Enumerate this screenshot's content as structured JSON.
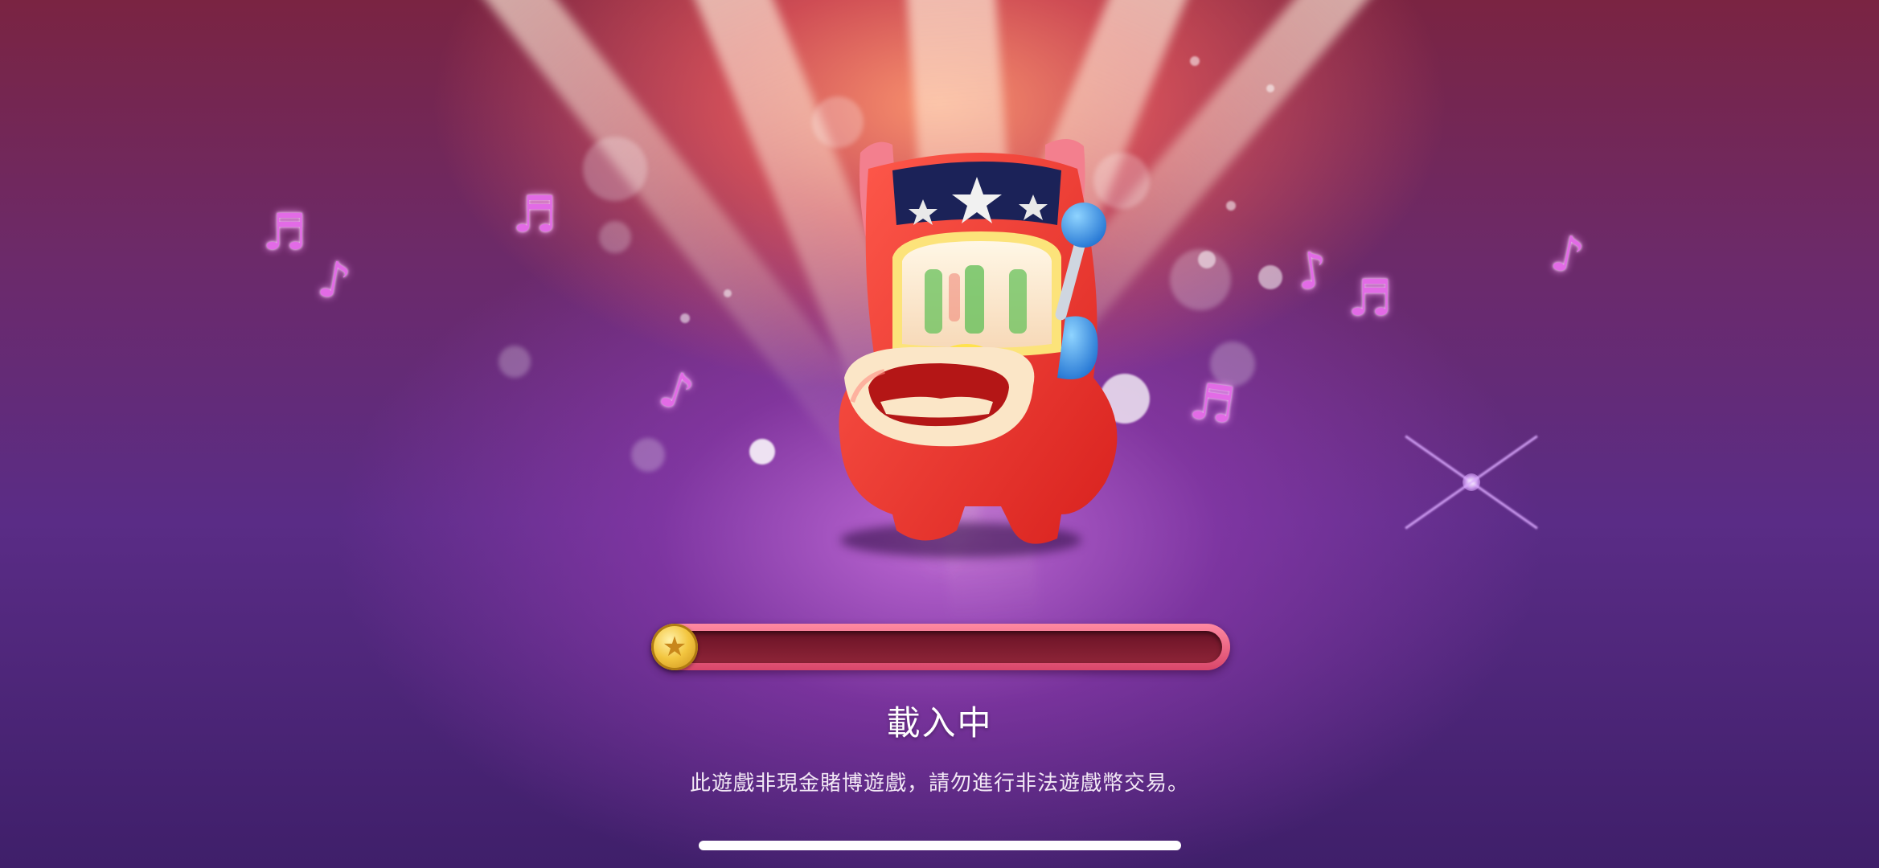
{
  "loading": {
    "label": "載入中",
    "progress": 0.02
  },
  "notice": "此遊戲非現金賭博遊戲，請勿進行非法遊戲幣交易。",
  "mascot": {
    "icon": "slot-machine-mascot-icon"
  },
  "decor": {
    "note_glyphs": [
      "♬",
      "♪",
      "♬",
      "♪",
      "♪",
      "♬",
      "♬",
      "♪",
      "♪"
    ]
  },
  "colors": {
    "progress_frame": "#e75c7a",
    "progress_track": "#7a1a2e",
    "coin": "#f3c640",
    "note": "#e26be6"
  }
}
